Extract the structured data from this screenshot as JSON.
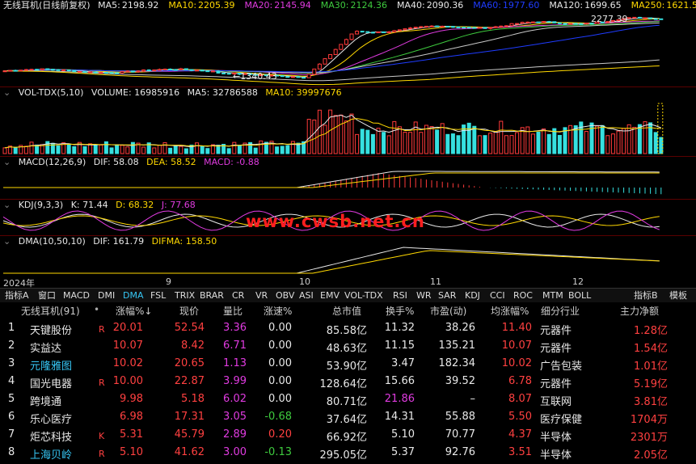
{
  "main_chart": {
    "title": "无线耳机(日线前复权)",
    "ma": [
      {
        "label": "MA5:",
        "value": "2198.92",
        "color": "#e8e8e8"
      },
      {
        "label": "MA10:",
        "value": "2205.39",
        "color": "#ffd800"
      },
      {
        "label": "MA20:",
        "value": "2145.94",
        "color": "#e03be0"
      },
      {
        "label": "MA30:",
        "value": "2124.36",
        "color": "#3ecb3e"
      },
      {
        "label": "MA40:",
        "value": "2090.36",
        "color": "#e8e8e8"
      },
      {
        "label": "MA60:",
        "value": "1977.60",
        "color": "#1f3cff"
      },
      {
        "label": "MA120:",
        "value": "1699.65",
        "color": "#e8e8e8"
      },
      {
        "label": "MA250:",
        "value": "1621.5",
        "color": "#ffd800"
      }
    ],
    "high_label": "2277.39",
    "low_label": "1340.43"
  },
  "volume_chart": {
    "title": "VOL-TDX(5,10)",
    "volume_label": "VOLUME: 16985916",
    "ma5_label": "MA5: 32786588",
    "ma10_label": "MA10: 39997676"
  },
  "macd_chart": {
    "title": "MACD(12,26,9)",
    "dif_label": "DIF: 58.08",
    "dea_label": "DEA: 58.52",
    "macd_label": "MACD: -0.88"
  },
  "kdj_chart": {
    "title": "KDJ(9,3,3)",
    "k_label": "K: 71.44",
    "d_label": "D: 68.32",
    "j_label": "J: 77.68"
  },
  "dma_chart": {
    "title": "DMA(10,50,10)",
    "dif_label": "DIF: 161.79",
    "difma_label": "DIFMA: 158.50"
  },
  "watermark": "www.cwsb.net.cn",
  "x_axis": {
    "year": "2024年",
    "months": [
      "9",
      "10",
      "11",
      "12"
    ]
  },
  "tabs": [
    "指标A",
    "窗口",
    "MACD",
    "DMI",
    "DMA",
    "FSL",
    "TRIX",
    "BRAR",
    "CR",
    "VR",
    "OBV",
    "ASI",
    "EMV",
    "VOL-TDX",
    "RSI",
    "WR",
    "SAR",
    "KDJ",
    "CCI",
    "ROC",
    "MTM",
    "BOLL"
  ],
  "active_tab": "DMA",
  "right_tabs": [
    "指标B",
    "模板"
  ],
  "table": {
    "block_name": "无线耳机(91)",
    "block_marker": "•",
    "columns": [
      "涨幅%↓",
      "现价",
      "量比",
      "涨速%",
      "总市值",
      "换手%",
      "市盈(动)",
      "均涨幅%",
      "细分行业",
      "主力净额"
    ],
    "rows": [
      {
        "no": "1",
        "name": "天键股份",
        "flag": "R",
        "chg": "20.01",
        "price": "52.54",
        "vr": "3.36",
        "speed": "0.00",
        "mcap": "85.58",
        "mcap_unit": "亿",
        "turn": "11.32",
        "pe": "38.26",
        "avg": "11.40",
        "ind": "元器件",
        "net": "1.28",
        "net_unit": "亿"
      },
      {
        "no": "2",
        "name": "实益达",
        "flag": "",
        "chg": "10.07",
        "price": "8.42",
        "vr": "6.71",
        "speed": "0.00",
        "mcap": "48.63",
        "mcap_unit": "亿",
        "turn": "11.15",
        "pe": "135.21",
        "avg": "10.07",
        "ind": "元器件",
        "net": "1.54",
        "net_unit": "亿"
      },
      {
        "no": "3",
        "name": "元隆雅图",
        "flag": "",
        "chg": "10.02",
        "price": "20.65",
        "vr": "1.13",
        "speed": "0.00",
        "mcap": "53.90",
        "mcap_unit": "亿",
        "turn": "3.47",
        "pe": "182.34",
        "avg": "10.02",
        "ind": "广告包装",
        "net": "1.01",
        "net_unit": "亿"
      },
      {
        "no": "4",
        "name": "国光电器",
        "flag": "R",
        "chg": "10.00",
        "price": "22.87",
        "vr": "3.99",
        "speed": "0.00",
        "mcap": "128.64",
        "mcap_unit": "亿",
        "turn": "15.66",
        "pe": "39.52",
        "avg": "6.78",
        "ind": "元器件",
        "net": "5.19",
        "net_unit": "亿"
      },
      {
        "no": "5",
        "name": "跨境通",
        "flag": "",
        "chg": "9.98",
        "price": "5.18",
        "vr": "6.02",
        "speed": "0.00",
        "mcap": "80.71",
        "mcap_unit": "亿",
        "turn": "21.86",
        "pe": "–",
        "avg": "8.07",
        "ind": "互联网",
        "net": "3.81",
        "net_unit": "亿"
      },
      {
        "no": "6",
        "name": "乐心医疗",
        "flag": "",
        "chg": "6.98",
        "price": "17.31",
        "vr": "3.05",
        "speed": "-0.68",
        "mcap": "37.64",
        "mcap_unit": "亿",
        "turn": "14.31",
        "pe": "55.88",
        "avg": "5.50",
        "ind": "医疗保健",
        "net": "1704",
        "net_unit": "万"
      },
      {
        "no": "7",
        "name": "炬芯科技",
        "flag": "K",
        "chg": "5.31",
        "price": "45.79",
        "vr": "2.89",
        "speed": "0.20",
        "mcap": "66.92",
        "mcap_unit": "亿",
        "turn": "5.10",
        "pe": "70.77",
        "avg": "4.37",
        "ind": "半导体",
        "net": "2301",
        "net_unit": "万"
      },
      {
        "no": "8",
        "name": "上海贝岭",
        "flag": "R",
        "chg": "5.10",
        "price": "41.62",
        "vr": "3.00",
        "speed": "-0.13",
        "mcap": "295.05",
        "mcap_unit": "亿",
        "turn": "5.37",
        "pe": "92.76",
        "avg": "3.51",
        "ind": "半导体",
        "net": "2.05",
        "net_unit": "亿"
      }
    ]
  }
}
